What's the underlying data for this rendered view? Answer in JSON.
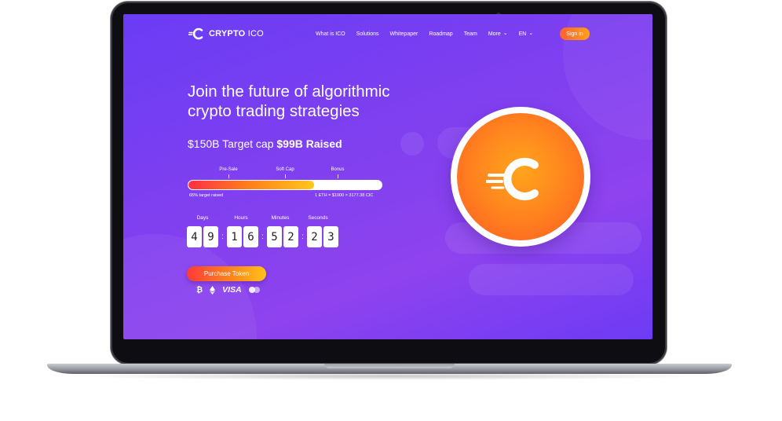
{
  "brand": {
    "name_bold": "CRYPTO",
    "name_rest": " ICO"
  },
  "nav": {
    "items": [
      "What is ICO",
      "Solutions",
      "Whitepaper",
      "Roadmap",
      "Team"
    ],
    "more_label": "More",
    "lang_label": "EN",
    "signin_label": "Sign in"
  },
  "hero": {
    "headline_line1": "Join the future of algorithmic",
    "headline_line2": "crypto trading strategies",
    "target_cap": "$150B Target cap",
    "raised": "$99B Raised"
  },
  "progress": {
    "milestones": [
      "Pre-Sale",
      "Soft Cap",
      "Bonus"
    ],
    "fill_fraction": 0.65,
    "left_text": "65% target raised",
    "right_text": "1 ETH = $1000 = 3177.38 CIC"
  },
  "countdown": {
    "labels": [
      "Days",
      "Hours",
      "Minutes",
      "Seconds"
    ],
    "days": [
      "4",
      "9"
    ],
    "hours": [
      "1",
      "6"
    ],
    "minutes": [
      "5",
      "2"
    ],
    "seconds": [
      "2",
      "3"
    ],
    "separator": ":"
  },
  "cta": {
    "purchase_label": "Purchase Token"
  },
  "payments": {
    "bitcoin_icon": "bitcoin-icon",
    "ethereum_icon": "ethereum-icon",
    "visa": "VISA",
    "mastercard_icon": "mastercard-icon"
  },
  "colors": {
    "accent_orange": "#ff8a1e",
    "accent_red": "#ff3a3a",
    "bg_purple": "#7c3ff0"
  }
}
